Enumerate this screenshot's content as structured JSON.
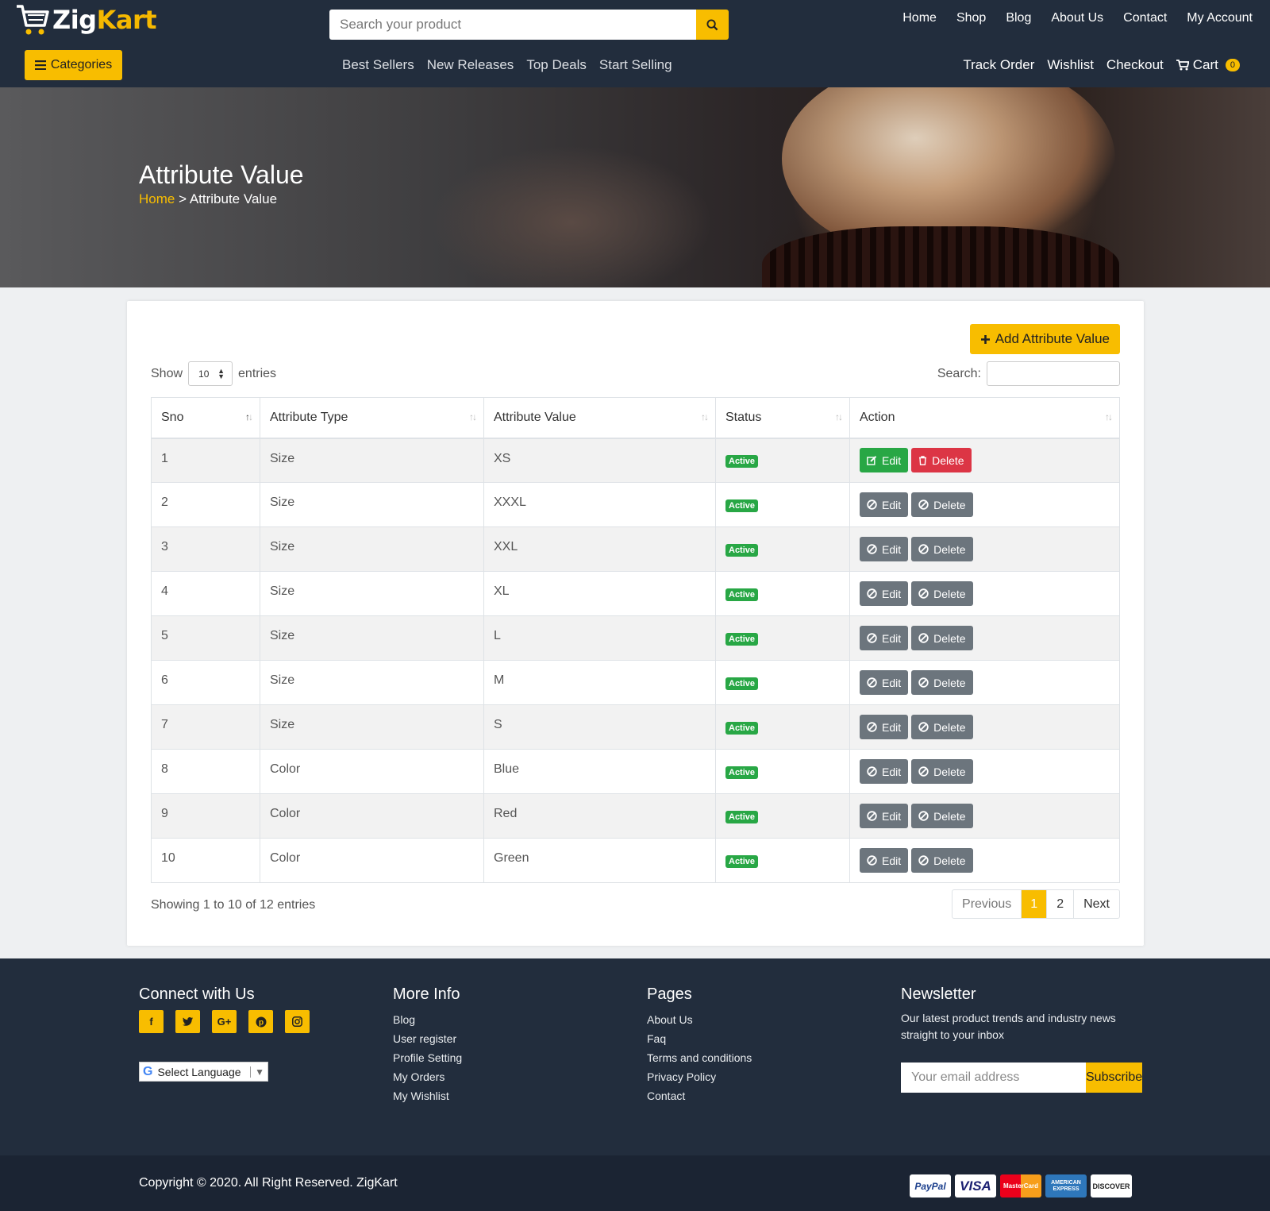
{
  "brand": {
    "part1": "Zig",
    "part2": "Kart"
  },
  "search": {
    "placeholder": "Search your product"
  },
  "topnav": [
    "Home",
    "Shop",
    "Blog",
    "About Us",
    "Contact",
    "My Account"
  ],
  "categories_label": "Categories",
  "midnav": [
    "Best Sellers",
    "New Releases",
    "Top Deals",
    "Start Selling"
  ],
  "rightnav": {
    "track": "Track Order",
    "wishlist": "Wishlist",
    "checkout": "Checkout",
    "cart": "Cart",
    "cart_count": "0"
  },
  "banner": {
    "title": "Attribute Value",
    "crumb_home": "Home",
    "crumb_sep": ">",
    "crumb_current": "Attribute Value"
  },
  "add_button": "Add Attribute Value",
  "length": {
    "show": "Show",
    "value": "10",
    "entries": "entries"
  },
  "filter_label": "Search:",
  "table": {
    "headers": [
      "Sno",
      "Attribute Type",
      "Attribute Value",
      "Status",
      "Action"
    ],
    "rows": [
      {
        "sno": "1",
        "type": "Size",
        "value": "XS",
        "status": "Active"
      },
      {
        "sno": "2",
        "type": "Size",
        "value": "XXXL",
        "status": "Active"
      },
      {
        "sno": "3",
        "type": "Size",
        "value": "XXL",
        "status": "Active"
      },
      {
        "sno": "4",
        "type": "Size",
        "value": "XL",
        "status": "Active"
      },
      {
        "sno": "5",
        "type": "Size",
        "value": "L",
        "status": "Active"
      },
      {
        "sno": "6",
        "type": "Size",
        "value": "M",
        "status": "Active"
      },
      {
        "sno": "7",
        "type": "Size",
        "value": "S",
        "status": "Active"
      },
      {
        "sno": "8",
        "type": "Color",
        "value": "Blue",
        "status": "Active"
      },
      {
        "sno": "9",
        "type": "Color",
        "value": "Red",
        "status": "Active"
      },
      {
        "sno": "10",
        "type": "Color",
        "value": "Green",
        "status": "Active"
      }
    ],
    "edit_label": "Edit",
    "delete_label": "Delete"
  },
  "info": "Showing 1 to 10 of 12 entries",
  "pager": {
    "prev": "Previous",
    "pages": [
      "1",
      "2"
    ],
    "next": "Next"
  },
  "footer": {
    "connect": {
      "title": "Connect with Us",
      "socials": [
        "f",
        "t",
        "G+",
        "p",
        "ig"
      ],
      "language": "Select Language"
    },
    "more": {
      "title": "More Info",
      "links": [
        "Blog",
        "User register",
        "Profile Setting",
        "My Orders",
        "My Wishlist"
      ]
    },
    "pages": {
      "title": "Pages",
      "links": [
        "About Us",
        "Faq",
        "Terms and conditions",
        "Privacy Policy",
        "Contact"
      ]
    },
    "newsletter": {
      "title": "Newsletter",
      "text": "Our latest product trends and industry news straight to your inbox",
      "placeholder": "Your email address",
      "button": "Subscribe"
    }
  },
  "copyright": "Copyright © 2020. All Right Reserved. ZigKart",
  "payment_cards": [
    "PayPal",
    "VISA",
    "MasterCard",
    "AMERICAN EXPRESS",
    "DISCOVER"
  ],
  "colors": {
    "accent": "#f8bd00",
    "header": "#222d3d",
    "success": "#28a745",
    "danger": "#dc3545",
    "muted": "#6c757d"
  }
}
